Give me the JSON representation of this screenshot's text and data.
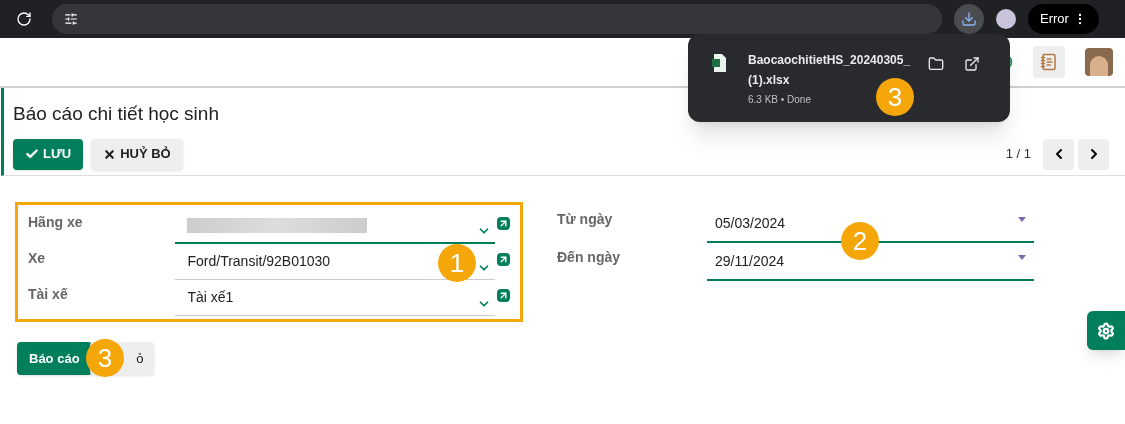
{
  "browser": {
    "profile_label": "Error"
  },
  "download": {
    "file_name_lines": [
      "BaocaochitietHS_20240305_",
      "(1).xlsx"
    ],
    "status": "6.3 KB • Done"
  },
  "page": {
    "title": "Báo cáo chi tiết học sinh",
    "pager": "1 / 1"
  },
  "actions": [
    {
      "kind": "primary",
      "label": "LƯU"
    },
    {
      "kind": "secondary",
      "label": "HUỶ BỎ"
    }
  ],
  "left_fields": [
    {
      "label": "Hãng xe",
      "redacted": true,
      "focused": true
    },
    {
      "label": "Xe",
      "value": "Ford/Transit/92B01030",
      "redacted": false,
      "focused": false
    },
    {
      "label": "Tài xế",
      "value": "Tài xế1",
      "redacted": false,
      "focused": false
    }
  ],
  "date_fields": [
    {
      "label": "Từ ngày",
      "value": "05/03/2024"
    },
    {
      "label": "Đến ngày",
      "value": "29/11/2024"
    }
  ],
  "footer_buttons": [
    {
      "kind": "primary",
      "label": "Báo cáo"
    },
    {
      "kind": "secondary",
      "label": "ỏ"
    }
  ],
  "annotations": [
    "1",
    "2",
    "3",
    "3"
  ]
}
